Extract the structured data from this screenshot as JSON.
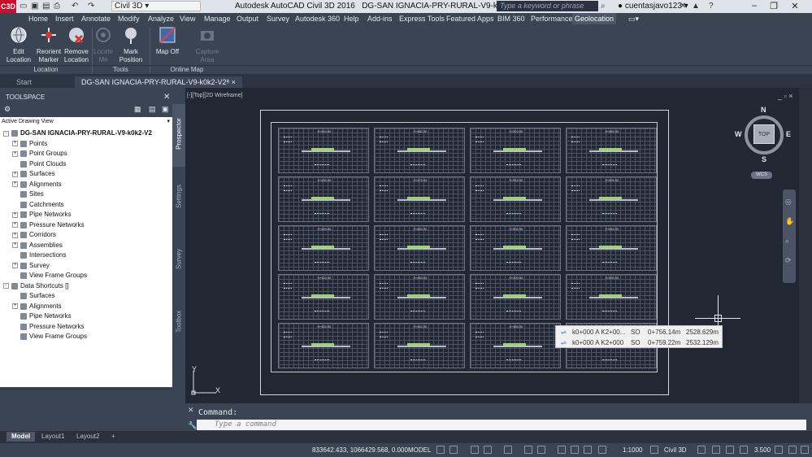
{
  "titlebar": {
    "logo": "C3D",
    "workspace": "Civil 3D",
    "app_title": "Autodesk AutoCAD Civil 3D 2016",
    "file_title": "DG-SAN IGNACIA-PRY-RURAL-V9-k0k2-V2.dwg",
    "search_placeholder": "Type a keyword or phrase",
    "user": "cuentasjavo123",
    "help": "?"
  },
  "ribbon_tabs": [
    "Home",
    "Insert",
    "Annotate",
    "Modify",
    "Analyze",
    "View",
    "Manage",
    "Output",
    "Survey",
    "Autodesk 360",
    "Help",
    "Add-ins",
    "Express Tools",
    "Featured Apps",
    "BIM 360",
    "Performance",
    "Geolocation"
  ],
  "active_ribbon_tab": "Geolocation",
  "ribbon": {
    "edit_location": "Edit Location",
    "reorient_marker": "Reorient Marker",
    "remove_location": "Remove Location",
    "locate_me": "Locate Me",
    "mark_position": "Mark Position",
    "map_off": "Map Off",
    "capture_area": "Capture Area",
    "panel_location": "Location",
    "panel_tools": "Tools",
    "panel_online_map": "Online Map"
  },
  "doc_tabs": {
    "start": "Start",
    "drawing": "DG-SAN IGNACIA-PRY-RURAL-V9-k0k2-V2*"
  },
  "toolspace": {
    "title": "TOOLSPACE",
    "view_combo": "Active Drawing View",
    "vertical_tabs": [
      "Prospector",
      "Settings",
      "Survey",
      "Toolbox"
    ],
    "tree": [
      {
        "label": "DG-SAN IGNACIA-PRY-RURAL-V9-k0k2-V2",
        "level": 0,
        "expander": "-",
        "root": true
      },
      {
        "label": "Points",
        "level": 1,
        "expander": "+"
      },
      {
        "label": "Point Groups",
        "level": 1,
        "expander": "+"
      },
      {
        "label": "Point Clouds",
        "level": 1,
        "expander": ""
      },
      {
        "label": "Surfaces",
        "level": 1,
        "expander": "+"
      },
      {
        "label": "Alignments",
        "level": 1,
        "expander": "+"
      },
      {
        "label": "Sites",
        "level": 1,
        "expander": ""
      },
      {
        "label": "Catchments",
        "level": 1,
        "expander": ""
      },
      {
        "label": "Pipe Networks",
        "level": 1,
        "expander": "+"
      },
      {
        "label": "Pressure Networks",
        "level": 1,
        "expander": "+"
      },
      {
        "label": "Corridors",
        "level": 1,
        "expander": "+"
      },
      {
        "label": "Assemblies",
        "level": 1,
        "expander": "+"
      },
      {
        "label": "Intersections",
        "level": 1,
        "expander": ""
      },
      {
        "label": "Survey",
        "level": 1,
        "expander": "+"
      },
      {
        "label": "View Frame Groups",
        "level": 1,
        "expander": ""
      },
      {
        "label": "Data Shortcuts []",
        "level": 0,
        "expander": "-"
      },
      {
        "label": "Surfaces",
        "level": 1,
        "expander": ""
      },
      {
        "label": "Alignments",
        "level": 1,
        "expander": "+"
      },
      {
        "label": "Pipe Networks",
        "level": 1,
        "expander": ""
      },
      {
        "label": "Pressure Networks",
        "level": 1,
        "expander": ""
      },
      {
        "label": "View Frame Groups",
        "level": 1,
        "expander": ""
      }
    ]
  },
  "viewport": {
    "label": "[-][Top][2D Wireframe]",
    "controls": "_ ▫ ×",
    "viewcube": {
      "top": "TOP",
      "n": "N",
      "s": "S",
      "e": "E",
      "w": "W",
      "wcs": "WCS"
    },
    "ucs_x": "X",
    "ucs_y": "Y",
    "sections": [
      [
        "0+440.00",
        "0+480.00",
        "0+520.00",
        "0+560.00"
      ],
      [
        "0+430.00",
        "0+470.00",
        "0+510.00",
        "0+550.00"
      ],
      [
        "0+420.00",
        "0+460.00",
        "0+500.00",
        "0+540.00"
      ],
      [
        "0+410.00",
        "0+450.00",
        "0+490.00",
        "0+530.00"
      ],
      [
        "0+400.00",
        "0+440.00",
        "0+480.00",
        "0+520.00"
      ]
    ]
  },
  "tooltip": {
    "rows": [
      {
        "name": "k0+000 A K2+00...",
        "side": "SO",
        "station": "0+756.14m",
        "offset": "2528.629m"
      },
      {
        "name": "k0+000 A K2+000",
        "side": "SO",
        "station": "0+759.22m",
        "offset": "2532.129m"
      }
    ]
  },
  "command": {
    "label": "Command:",
    "placeholder": "Type a command"
  },
  "layout_tabs": [
    "Model",
    "Layout1",
    "Layout2"
  ],
  "statusbar": {
    "coords": "833642.433, 1066429.568, 0.000",
    "space": "MODEL",
    "scale": "1:1000",
    "workspace": "Civil 3D",
    "value": "3.500"
  }
}
